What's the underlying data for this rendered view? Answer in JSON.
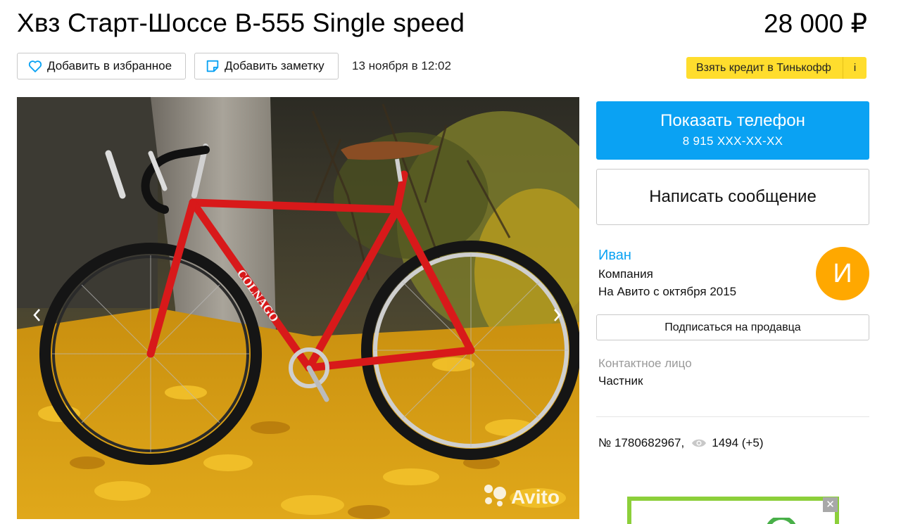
{
  "listing": {
    "title": "Хвз Старт-Шоссе В-555 Single speed",
    "price": "28 000 ₽",
    "date": "13 ноября в 12:02",
    "number_text": "№ 1780682967,",
    "views_text": "1494 (+5)"
  },
  "actions": {
    "favorite_label": "Добавить в избранное",
    "note_label": "Добавить заметку",
    "credit_label": "Взять кредит в Тинькофф",
    "credit_info": "i"
  },
  "contact": {
    "show_phone_label": "Показать телефон",
    "phone_masked": "8 915 XXX-XX-XX",
    "write_message_label": "Написать сообщение",
    "subscribe_label": "Подписаться на продавца",
    "contact_person_label": "Контактное лицо",
    "contact_person_value": "Частник"
  },
  "seller": {
    "name": "Иван",
    "type": "Компания",
    "since": "На Авито с октября 2015",
    "avatar_letter": "И"
  },
  "gallery": {
    "watermark": "Avito",
    "frame_text": "COLNAGO"
  },
  "ad": {
    "close_label": "✕"
  },
  "icons": {
    "favorite": "heart-icon",
    "note": "note-icon",
    "views": "eye-icon",
    "prev": "chevron-left-icon",
    "next": "chevron-right-icon"
  },
  "colors": {
    "primary_blue": "#0aa2f3",
    "credit_yellow": "#ffdd2d",
    "avatar_orange": "#ffa800",
    "ad_green": "#8ccf3a"
  }
}
